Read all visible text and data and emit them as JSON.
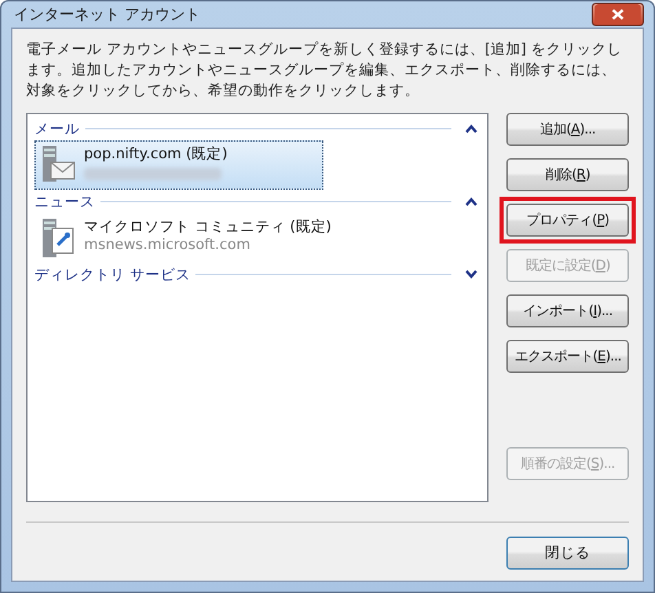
{
  "window": {
    "title": "インターネット アカウント"
  },
  "description": "電子メール アカウントやニュースグループを新しく登録するには、[追加] をクリックします。追加したアカウントやニュースグループを編集、エクスポート、削除するには、対象をクリックしてから、希望の動作をクリックします。",
  "groups": [
    {
      "title": "メール",
      "expanded": true,
      "accounts": [
        {
          "kind": "mail",
          "name": "pop.nifty.com (既定)",
          "selected": true,
          "detail_blurred": true
        }
      ]
    },
    {
      "title": "ニュース",
      "expanded": true,
      "accounts": [
        {
          "kind": "news",
          "name": "マイクロソフト コミュニティ (既定)",
          "detail": "msnews.microsoft.com",
          "selected": false
        }
      ]
    },
    {
      "title": "ディレクトリ サービス",
      "expanded": false
    }
  ],
  "buttons": [
    {
      "label": "追加(",
      "accesskey": "A",
      "label_end": ")...",
      "disabled": false,
      "highlighted": false
    },
    {
      "label": "削除(",
      "accesskey": "R",
      "label_end": ")",
      "disabled": false,
      "highlighted": false
    },
    {
      "label": "プロパティ(",
      "accesskey": "P",
      "label_end": ")",
      "disabled": false,
      "highlighted": true
    },
    {
      "label": "既定に設定(",
      "accesskey": "D",
      "label_end": ")",
      "disabled": true,
      "highlighted": false
    },
    {
      "label": "インポート(",
      "accesskey": "I",
      "label_end": ")...",
      "disabled": false,
      "highlighted": false
    },
    {
      "label": "エクスポート(",
      "accesskey": "E",
      "label_end": ")...",
      "disabled": false,
      "highlighted": false
    },
    {
      "label": "順番の設定(",
      "accesskey": "S",
      "label_end": ")...",
      "disabled": true,
      "highlighted": false
    }
  ],
  "close_button": {
    "label": "閉じる"
  }
}
